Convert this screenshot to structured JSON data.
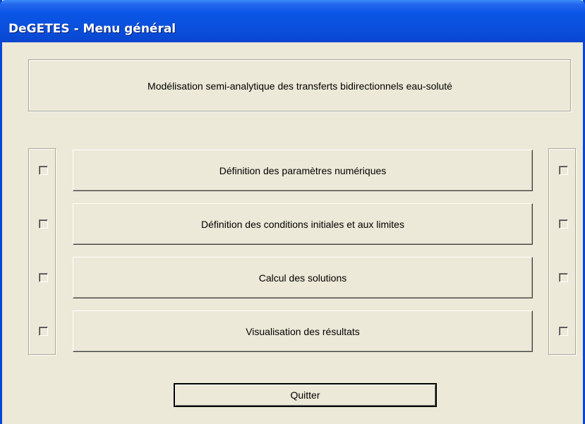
{
  "window": {
    "title": "DeGETES - Menu général",
    "accent_color": "#0a50dc",
    "background_color": "#ece9d8"
  },
  "header": {
    "subtitle": "Modélisation semi-analytique des transferts bidirectionnels eau-soluté"
  },
  "menu": {
    "buttons": [
      {
        "label": "Définition des paramètres numériques"
      },
      {
        "label": "Définition des conditions initiales et aux limites"
      },
      {
        "label": "Calcul des solutions"
      },
      {
        "label": "Visualisation des résultats"
      }
    ]
  },
  "checkboxes": {
    "left": [
      false,
      false,
      false,
      false
    ],
    "right": [
      false,
      false,
      false,
      false
    ]
  },
  "footer": {
    "quit_label": "Quitter"
  }
}
